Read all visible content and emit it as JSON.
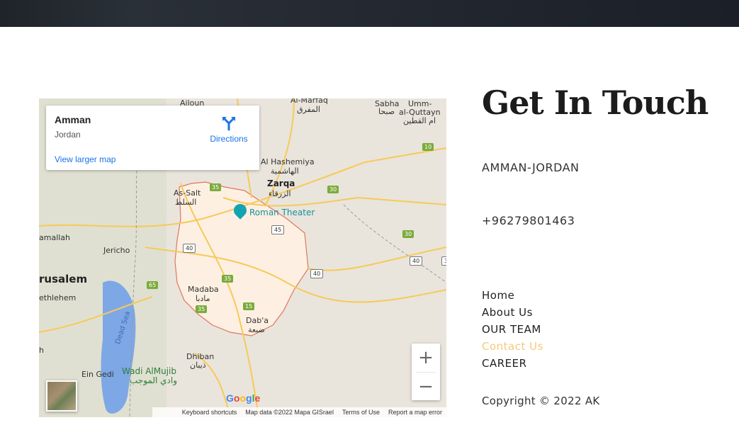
{
  "map": {
    "info_card": {
      "place_name": "Amman",
      "place_sub": "Jordan",
      "larger_map_link": "View larger map",
      "directions_label": "Directions"
    },
    "poi": "Roman Theater",
    "labels": {
      "ailoun": "Ailoun",
      "al_mafraq": "Al-Marfaq",
      "al_mafraq_ar": "المفرق",
      "sabha": "Sabha",
      "sabha_ar": "صبحا",
      "umm_al_quttayn": "Umm-",
      "umm_al_quttayn_2": "al-Quttayn",
      "umm_al_quttayn_ar": "ام القطين",
      "al_hashemiya": "Al Hashemiya",
      "al_hashemiya_ar": "الهاشمية",
      "zarqa": "Zarqa",
      "zarqa_ar": "الزرقاء",
      "as_salt": "As-Salt",
      "as_salt_ar": "السلط",
      "ramallah": "amallah",
      "jericho": "Jericho",
      "jerusalem": "rusalem",
      "bethlehem": "ethlehem",
      "madaba": "Madaba",
      "madaba_ar": "مادبا",
      "dhaba": "Dab'a",
      "dhaba_ar": "ضبعة",
      "dead_sea": "Dead Sea",
      "dhiban": "Dhiban",
      "dhiban_ar": "ذيبان",
      "ein_gedi": "Ein Gedi",
      "wadi_almujib": "Wadi AlMujib",
      "wadi_almujib_ar": "وادي الموجب",
      "h_marker": "h"
    },
    "shields": {
      "s10": "10",
      "s35a": "35",
      "s30a": "30",
      "s45": "45",
      "s40a": "40",
      "s30b": "30",
      "s40b": "40",
      "s40c": "40",
      "s3": "3",
      "s65": "65",
      "s35b": "35",
      "s15": "15",
      "s35c": "35"
    },
    "zoom_in": "+",
    "zoom_out": "−",
    "google_logo": "Google",
    "attribution": {
      "shortcuts": "Keyboard shortcuts",
      "map_data": "Map data ©2022 Mapa GISrael",
      "terms": "Terms of Use",
      "report": "Report a map error"
    },
    "colors": {
      "land": "#e9e5dc",
      "water": "#7ea7e6",
      "boundary": "#e0765f",
      "road": "#f7c959",
      "highlight": "#fdf0e2"
    }
  },
  "contact": {
    "heading": "Get In Touch",
    "location": "AMMAN-JORDAN",
    "phone": "+96279801463"
  },
  "nav": {
    "home": "Home",
    "about": "About Us",
    "team": "OUR TEAM",
    "contact": "Contact Us",
    "career": "CAREER",
    "active_color": "#f7c979"
  },
  "footer": {
    "copyright": "Copyright © 2022 AK"
  }
}
